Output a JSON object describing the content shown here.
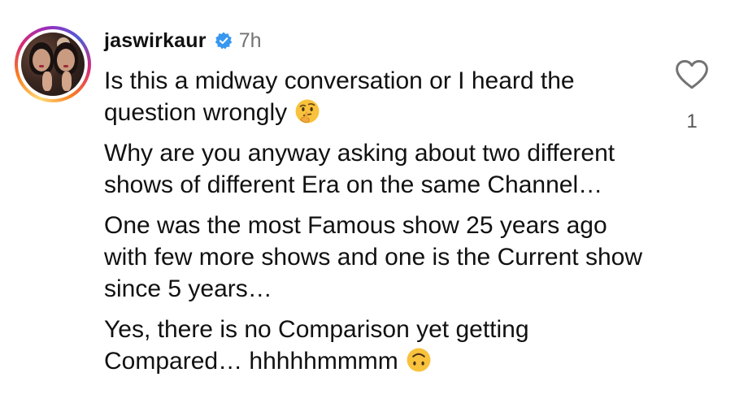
{
  "comment": {
    "username": "jaswirkaur",
    "verified": true,
    "timestamp": "7h",
    "paragraphs": [
      {
        "text": "Is this a midway conversation or I heard the question wrongly",
        "emoji": "thinking-face-emoji"
      },
      {
        "text": "Why are you anyway asking about two different shows of different Era on the same Channel…",
        "emoji": null
      },
      {
        "text": "One was the most Famous show 25 years ago with few more shows and one is the Current show since 5 years…",
        "emoji": null
      },
      {
        "text": "Yes, there is no Comparison yet getting Compared… hhhhhmmmm",
        "emoji": "upside-down-face-emoji"
      }
    ],
    "likes": "1"
  },
  "icons": {
    "like": "heart-outline-icon",
    "verified": "verified-badge-icon"
  },
  "colors": {
    "text": "#111111",
    "muted": "#737373",
    "verified_blue": "#3897f0",
    "emoji_yellow": "#f9c23c"
  }
}
